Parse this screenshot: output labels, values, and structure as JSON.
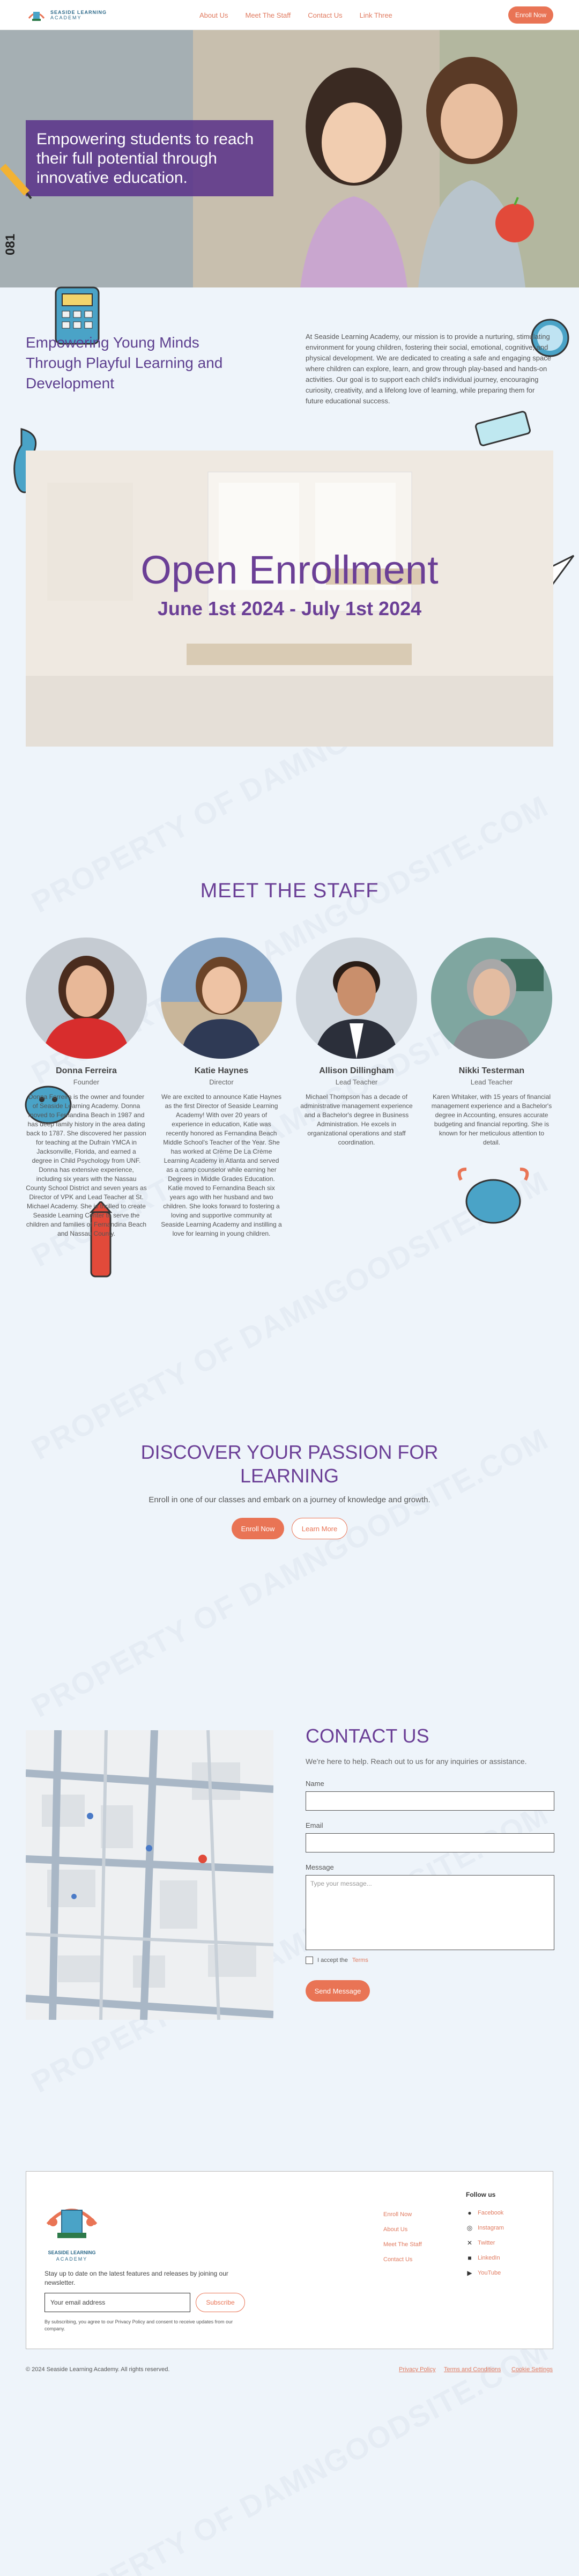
{
  "header": {
    "logo_line1": "SEASIDE LEARNING",
    "logo_line2": "ACADEMY",
    "nav": [
      "About Us",
      "Meet The Staff",
      "Contact Us",
      "Link Three"
    ],
    "enroll_label": "Enroll Now"
  },
  "hero": {
    "headline": "Empowering students to reach their full potential through innovative education.",
    "side_code": "081"
  },
  "mission": {
    "title": "Empowering Young Minds Through Playful Learning and Development",
    "text": "At Seaside Learning Academy, our mission is to provide a nurturing, stimulating environment for young children, fostering their social, emotional, cognitive, and physical development. We are dedicated to creating a safe and engaging space where children can explore, learn, and grow through play-based and hands-on activities. Our goal is to support each child's individual journey, encouraging curiosity, creativity, and a lifelong love of learning, while preparing them for future educational success."
  },
  "enrollment": {
    "title": "Open Enrollment",
    "dates": "June 1st 2024 - July 1st 2024"
  },
  "watermark": "PROPERTY OF DAMNGOODSITE.COM",
  "staff": {
    "title": "MEET THE STAFF",
    "members": [
      {
        "name": "Donna Ferreira",
        "role": "Founder",
        "bio": "Donna Ferreira is the owner and founder of Seaside Learning Academy. Donna moved to Fernandina Beach in 1987 and has deep family history in the area dating back to 1787. She discovered her passion for teaching at the Dufrain YMCA in Jacksonville, Florida, and earned a degree in Child Psychology from UNF. Donna has extensive experience, including six years with the Nassau County School District and seven years as Director of VPK and Lead Teacher at St. Michael Academy. She is thrilled to create Seaside Learning Center to serve the children and families of Fernandina Beach and Nassau County."
      },
      {
        "name": "Katie Haynes",
        "role": "Director",
        "bio": "We are excited to announce Katie Haynes as the first Director of Seaside Learning Academy! With over 20 years of experience in education, Katie was recently honored as Fernandina Beach Middle School's Teacher of the Year. She has worked at Crème De La Crème Learning Academy in Atlanta and served as a camp counselor while earning her Degrees in Middle Grades Education. Katie moved to Fernandina Beach six years ago with her husband and two children. She looks forward to fostering a loving and supportive community at Seaside Learning Academy and instilling a love for learning in young children."
      },
      {
        "name": "Allison Dillingham",
        "role": "Lead Teacher",
        "bio": "Michael Thompson has a decade of administrative management experience and a Bachelor's degree in Business Administration. He excels in organizational operations and staff coordination."
      },
      {
        "name": "Nikki Testerman",
        "role": "Lead Teacher",
        "bio": "Karen Whitaker, with 15 years of financial management experience and a Bachelor's degree in Accounting, ensures accurate budgeting and financial reporting. She is known for her meticulous attention to detail."
      }
    ]
  },
  "discover": {
    "title": "DISCOVER YOUR PASSION FOR LEARNING",
    "subtitle": "Enroll in one of our classes and embark on a journey of knowledge and growth.",
    "enroll_label": "Enroll Now",
    "learn_label": "Learn More"
  },
  "contact": {
    "title": "CONTACT US",
    "subtitle": "We're here to help. Reach out to us for any inquiries or assistance.",
    "name_label": "Name",
    "email_label": "Email",
    "message_label": "Message",
    "message_placeholder": "Type your message...",
    "terms_prefix": "I accept the",
    "terms_link": "Terms",
    "send_label": "Send Message"
  },
  "footer": {
    "newsletter_text": "Stay up to date on the latest features and releases by joining our newsletter.",
    "email_placeholder": "Your email address",
    "subscribe_label": "Subscribe",
    "privacy_note": "By subscribing, you agree to our Privacy Policy and consent to receive updates from our company.",
    "links": [
      "Enroll Now",
      "About Us",
      "Meet The Staff",
      "Contact Us"
    ],
    "follow_title": "Follow us",
    "social": [
      {
        "label": "Facebook",
        "icon": "facebook-icon"
      },
      {
        "label": "Instagram",
        "icon": "instagram-icon"
      },
      {
        "label": "Twitter",
        "icon": "x-icon"
      },
      {
        "label": "LinkedIn",
        "icon": "linkedin-icon"
      },
      {
        "label": "YouTube",
        "icon": "youtube-icon"
      }
    ],
    "copyright": "© 2024 Seaside Learning Academy. All rights reserved.",
    "legal": [
      "Privacy Policy",
      "Terms and Conditions",
      "Cookie Settings"
    ]
  },
  "colors": {
    "accent": "#e97455",
    "purple": "#6b3f96",
    "background": "#eef4fa"
  }
}
